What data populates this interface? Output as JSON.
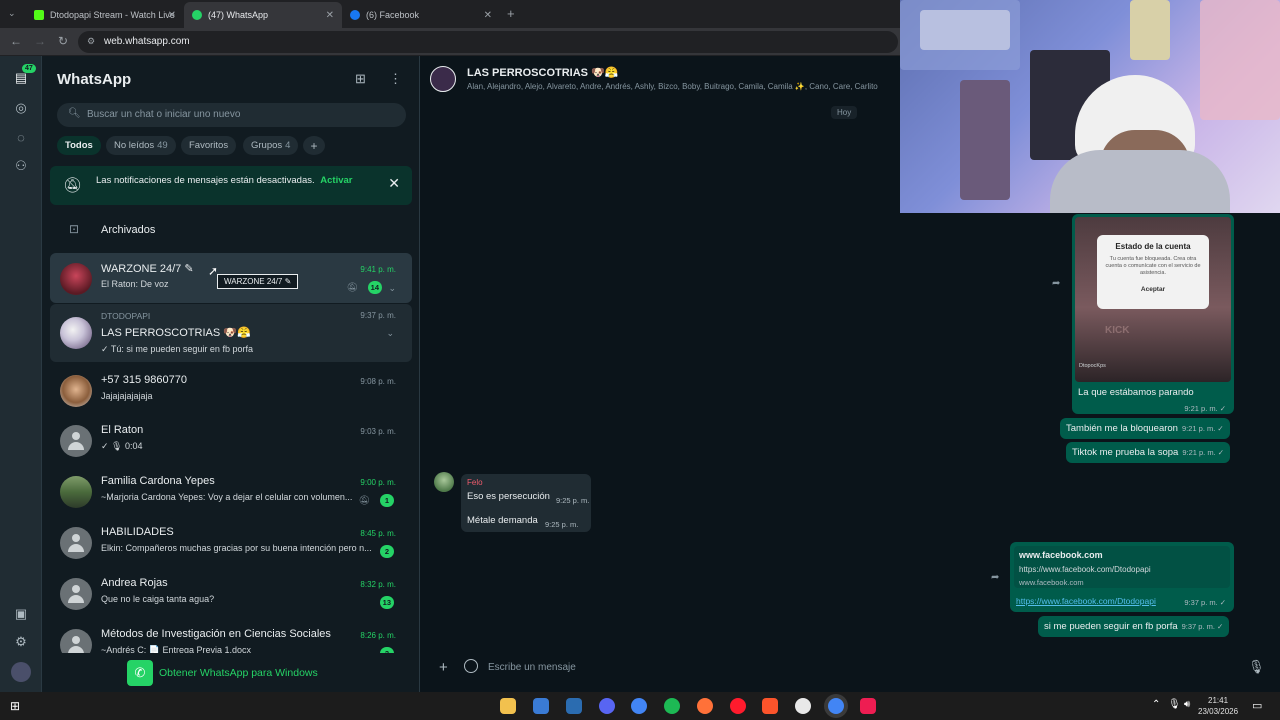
{
  "browser": {
    "tabs": [
      {
        "title": "Dtodopapi Stream - Watch Live",
        "color": "#53fc18"
      },
      {
        "title": "(47) WhatsApp",
        "color": "#25d366"
      },
      {
        "title": "(6) Facebook",
        "color": "#1877f2"
      }
    ],
    "new_tab_label": "+",
    "url": "web.whatsapp.com"
  },
  "rail": {
    "chats_badge": "47"
  },
  "sidebar": {
    "title": "WhatsApp",
    "search_placeholder": "Buscar un chat o iniciar uno nuevo",
    "filters": [
      {
        "label": "Todos",
        "count": ""
      },
      {
        "label": "No leídos",
        "count": "49"
      },
      {
        "label": "Favoritos",
        "count": ""
      },
      {
        "label": "Grupos",
        "count": "4"
      }
    ],
    "add_filter_label": "+",
    "notification_banner": {
      "text": "Las notificaciones de mensajes están desactivadas.",
      "action": "Activar"
    },
    "archived_label": "Archivados",
    "tooltip": "WARZONE 24/7 ✎",
    "chats": [
      {
        "name": "WARZONE 24/7 ✎",
        "preview": "El Raton: De voz",
        "time": "9:41 p. m.",
        "badge": "14"
      },
      {
        "sender": "DTODOPAPI",
        "name": "LAS PERROSCOTRIAS 🐶😤",
        "preview": "✓ Tú: si me pueden seguir en fb porfa",
        "time": "9:37 p. m."
      },
      {
        "name": "+57 315 9860770",
        "preview": "Jajajajajajaja",
        "time": "9:08 p. m."
      },
      {
        "name": "El Raton",
        "preview": "✓ 🎙 0:04",
        "time": "9:03 p. m."
      },
      {
        "name": "Familia Cardona Yepes",
        "preview": "~Marjoria Cardona Yepes: Voy a dejar el celular con volumen...",
        "time": "9:00 p. m.",
        "badge": "1"
      },
      {
        "name": "HABILIDADES",
        "preview": "Elkin: Compañeros muchas gracias por su buena intención pero n...",
        "time": "8:45 p. m.",
        "badge": "2"
      },
      {
        "name": "Andrea Rojas",
        "preview": "Que no le caiga tanta agua?",
        "time": "8:32 p. m.",
        "badge": "13"
      },
      {
        "name": "Métodos de Investigación en Ciencias Sociales",
        "preview": "~Andrés C: 📄 Entrega Previa 1.docx",
        "time": "8:26 p. m.",
        "badge": "2"
      }
    ],
    "get_windows_label": "Obtener WhatsApp para Windows"
  },
  "chat": {
    "group_name": "LAS PERROSCOTRIAS 🐶😤",
    "members": "Alan, Alejandro, Alejo, Alvareto, Andre, Andrés, Ashly, Bizco, Boby, Buitrago, Camila, Camila ✨, Cano, Care, Carlito",
    "day_chip": "Hoy",
    "image_message": {
      "dialog_title": "Estado de la cuenta",
      "dialog_text": "Tu cuenta fue bloqueada. Crea otra cuenta o comunícate con el servicio de asistencia.",
      "dialog_button": "Aceptar",
      "logo": "KICK",
      "footer": "DtopocKps",
      "caption": "La que estábamos parando",
      "time": "9:21 p. m."
    },
    "messages_out_1": [
      {
        "text": "También me la bloquearon",
        "time": "9:21 p. m."
      },
      {
        "text": "Tiktok me prueba la sopa",
        "time": "9:21 p. m."
      }
    ],
    "incoming": {
      "sender": "Felo",
      "messages": [
        {
          "text": "Eso es persecución",
          "time": "9:25 p. m."
        },
        {
          "text": "Métale demanda",
          "time": "9:25 p. m."
        }
      ]
    },
    "link_message": {
      "title": "www.facebook.com",
      "url": "https://www.facebook.com/Dtodopapi",
      "domain": "www.facebook.com",
      "link_text": "https://www.facebook.com/Dtodopapi",
      "time": "9:37 p. m."
    },
    "last_message": {
      "text": "si me pueden seguir en fb porfa",
      "time": "9:37 p. m."
    },
    "composer_placeholder": "Escribe un mensaje"
  },
  "taskbar": {
    "time": "21:41",
    "date": "23/03/2026"
  },
  "colors": {
    "accent": "#25d366",
    "outgoing_bubble": "#005c4b",
    "incoming_bubble": "#202c33",
    "background": "#0b141a"
  }
}
